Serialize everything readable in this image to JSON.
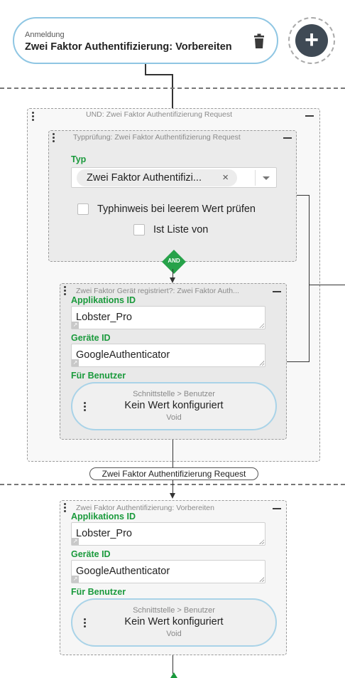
{
  "trigger": {
    "subtitle": "Anmeldung",
    "title": "Zwei Faktor Authentifizierung: Vorbereiten"
  },
  "and_block": {
    "title": "UND: Zwei Faktor Authentifizierung Request",
    "type_check": {
      "title": "Typprüfung: Zwei Faktor Authentifizierung Request",
      "type_label": "Typ",
      "type_value": "Zwei Faktor Authentifizi...",
      "chip_remove": "×",
      "checkbox_typhinweis": "Typhinweis bei leerem Wert prüfen",
      "checkbox_liste": "Ist Liste von"
    },
    "connector_label": "AND",
    "geraet_check": {
      "title": "Zwei Faktor Gerät registriert?: Zwei Faktor Auth...",
      "app_id_label": "Applikations ID",
      "app_id_value": "Lobster_Pro",
      "device_id_label": "Geräte ID",
      "device_id_value": "GoogleAuthenticator",
      "user_label": "Für Benutzer",
      "user_node": {
        "path": "Schnittstelle > Benutzer",
        "value": "Kein Wert konfiguriert",
        "type": "Void"
      }
    }
  },
  "edge_label": "Zwei Faktor Authentifizierung Request",
  "prepare_block": {
    "title": "Zwei Faktor Authentifizierung: Vorbereiten",
    "app_id_label": "Applikations ID",
    "app_id_value": "Lobster_Pro",
    "device_id_label": "Geräte ID",
    "device_id_value": "GoogleAuthenticator",
    "user_label": "Für Benutzer",
    "user_node": {
      "path": "Schnittstelle > Benutzer",
      "value": "Kein Wert konfiguriert",
      "type": "Void"
    }
  },
  "add_button": "+",
  "colors": {
    "accent_green": "#1a9a3c",
    "node_border": "#8fc6e3",
    "add_button": "#3f4a55"
  }
}
